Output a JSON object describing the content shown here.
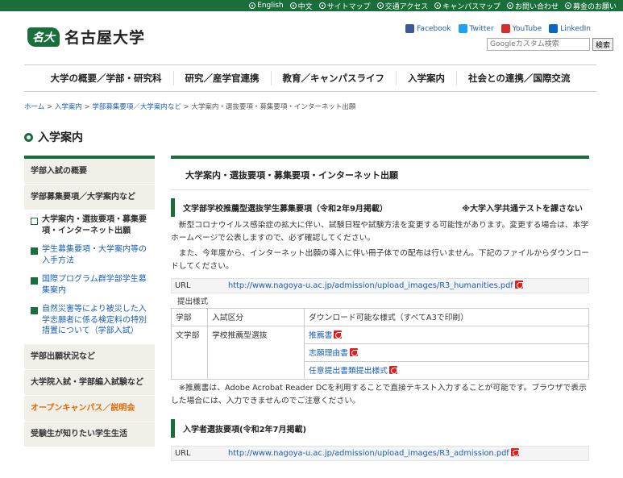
{
  "topbar": {
    "links": [
      "English",
      "中文",
      "サイトマップ",
      "交通アクセス",
      "キャンパスマップ",
      "お問い合わせ",
      "募金のお願い"
    ]
  },
  "header": {
    "logo_mark": "名大",
    "logo_text": "名古屋大学",
    "social": [
      "Facebook",
      "Twitter",
      "YouTube",
      "LinkedIn"
    ],
    "search_placeholder": "Googleカスタム検索",
    "search_button": "検索"
  },
  "gnav": [
    "大学の概要／学部・研究科",
    "研究／産学官連携",
    "教育／キャンパスライフ",
    "入学案内",
    "社会との連携／国際交流"
  ],
  "breadcrumb": {
    "items": [
      "ホーム",
      "入学案内",
      "学部募集要項／大学案内など"
    ],
    "sep": " > ",
    "current": "大学案内・選抜要項・募集要項・インターネット出願"
  },
  "page_title": "入学案内",
  "sidebar": {
    "item1": "学部入試の概要",
    "item2": "学部募集要項／大学案内など",
    "sub": [
      "大学案内・選抜要項・募集要項・インターネット出願",
      "学生募集要項・大学案内等の入手方法",
      "国際プログラム群学部学生募集案内",
      "自然災害等により被災した入学志願者に係る検定料の特別措置について（学部入試）"
    ],
    "item3": "学部出願状況など",
    "item4": "大学院入試・学部編入試験など",
    "item5": "オープンキャンパス／説明会",
    "item6": "受験生が知りたい学生生活"
  },
  "main": {
    "h2": "大学案内・選抜要項・募集要項・インターネット出願",
    "section1": {
      "title": "文学部学校推薦型選抜学生募集要項（令和2年9月掲載）",
      "title_note": "※大学入学共通テストを課さない",
      "para1": "新型コロナウイルス感染症の拡大に伴い、試験日程や試験方法を変更する可能性があります。変更する場合は、本学ホームページで公表しますので、必ず確認してください。",
      "para2": "また、今年度から、インターネット出願の導入に伴い冊子体での配布は行いません。下記のファイルからダウンロードしてください。",
      "url_label": "URL",
      "url": "http://www.nagoya-u.ac.jp/admission/upload_images/R3_humanities.pdf",
      "table_caption": "提出様式",
      "table_head": [
        "学部",
        "入試区分",
        "ダウンロード可能な様式（すべてA3で印刷）"
      ],
      "faculty": "文学部",
      "category": "学校推薦型選抜",
      "forms": [
        "推薦書",
        "志願理由書",
        "任意提出書類提出様式"
      ],
      "note": "※推薦書は、Adobe Acrobat Reader DCを利用することで直接テキスト入力することが可能です。ブラウザで表示した場合には、入力できませんのでご注意ください。"
    },
    "section2": {
      "title": "入学者選抜要項(令和2年7月掲載)",
      "url_label": "URL",
      "url": "http://www.nagoya-u.ac.jp/admission/upload_images/R3_admission.pdf"
    }
  },
  "colors": {
    "brand_green": "#1a6e3c",
    "link_blue": "#1a5fb4",
    "accent_orange": "#e06a00",
    "pdf_red": "#e21b1b"
  }
}
